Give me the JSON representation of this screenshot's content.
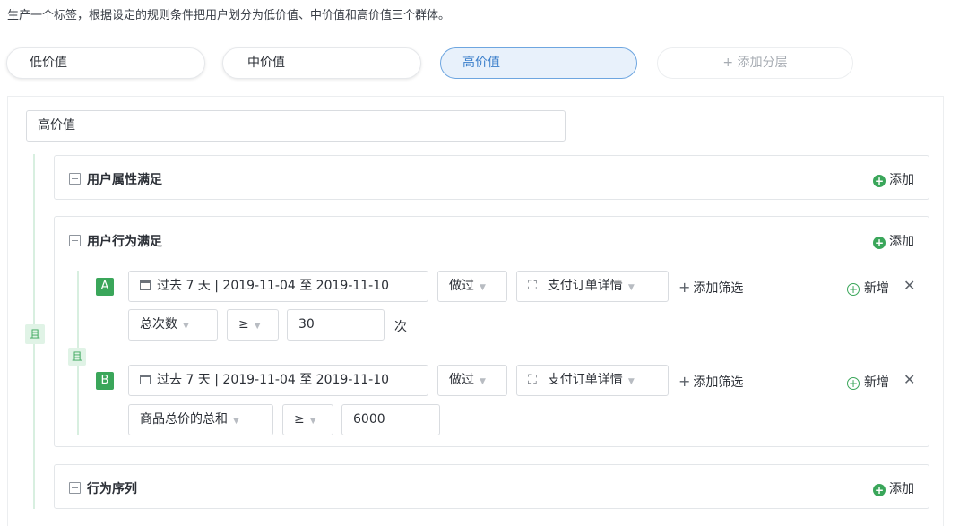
{
  "intro": "生产一个标签，根据设定的规则条件把用户划分为低价值、中价值和高价值三个群体。",
  "tiers": [
    "低价值",
    "中价值",
    "高价值"
  ],
  "add_tier": "+ 添加分层",
  "tier_name_value": "高价值",
  "and_label": "且",
  "groups": {
    "attr": {
      "title": "用户属性满足",
      "add": "添加"
    },
    "behavior": {
      "title": "用户行为满足",
      "add": "添加"
    },
    "sequence": {
      "title": "行为序列",
      "add": "添加"
    }
  },
  "rules": {
    "a": {
      "badge": "A",
      "date_range": "过去 7 天 | 2019-11-04 至 2019-11-10",
      "action": "做过",
      "event": "支付订单详情",
      "add_filter": "添加筛选",
      "new": "新增",
      "metric": "总次数",
      "operator": "≥",
      "value": "30",
      "unit": "次"
    },
    "b": {
      "badge": "B",
      "date_range": "过去 7 天 | 2019-11-04 至 2019-11-10",
      "action": "做过",
      "event": "支付订单详情",
      "add_filter": "添加筛选",
      "new": "新增",
      "metric": "商品总价的总和",
      "operator": "≥",
      "value": "6000"
    }
  },
  "icons": {
    "collapse": "minus-square-icon",
    "add": "plus-circle-icon",
    "calendar": "calendar-icon",
    "event": "event-scan-icon",
    "close": "close-icon"
  },
  "colors": {
    "accent_green": "#3aa65a",
    "active_tier_bg": "#e8f1fb",
    "active_tier_text": "#3b7fcb"
  }
}
